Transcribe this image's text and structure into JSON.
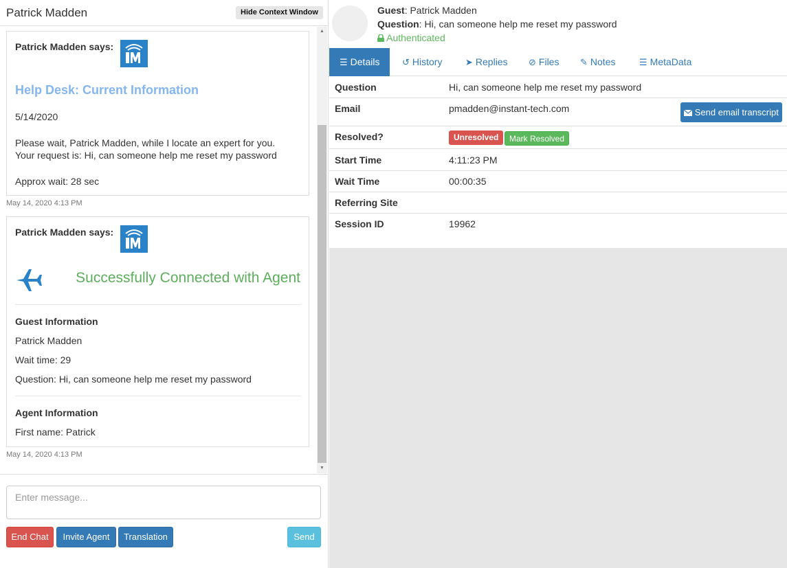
{
  "left": {
    "title": "Patrick Madden",
    "hide_context_label": "Hide Context Window"
  },
  "messages": [
    {
      "says": "Patrick Madden says:",
      "help_title": "Help Desk: Current Information",
      "date": "5/14/2020",
      "please_wait": "Please wait, Patrick Madden, while I locate an expert for you.",
      "request": "Your request is: Hi, can someone help me reset my password",
      "approx_wait": "Approx wait: 28 sec",
      "timestamp": "May 14, 2020 4:13 PM"
    },
    {
      "says": "Patrick Madden says:",
      "connected": "Successfully Connected with Agent",
      "guest_info_heading": "Guest Information",
      "guest_name": "Patrick Madden",
      "wait_time": "Wait time: 29",
      "question": "Question: Hi, can someone help me reset my password",
      "agent_info_heading": "Agent Information",
      "agent_first_name": "First name: Patrick",
      "timestamp": "May 14, 2020 4:13 PM"
    }
  ],
  "composer": {
    "placeholder": "Enter message...",
    "end_chat": "End Chat",
    "invite_agent": "Invite Agent",
    "translation": "Translation",
    "send": "Send"
  },
  "guest_header": {
    "guest_label": "Guest",
    "guest_value": "Patrick Madden",
    "question_label": "Question",
    "question_value": "Hi, can someone help me reset my password",
    "auth_status": "Authenticated"
  },
  "tabs": [
    {
      "label": "Details",
      "icon": "list-icon"
    },
    {
      "label": "History",
      "icon": "history-icon"
    },
    {
      "label": "Replies",
      "icon": "paper-plane-icon"
    },
    {
      "label": "Files",
      "icon": "paperclip-icon"
    },
    {
      "label": "Notes",
      "icon": "edit-icon"
    },
    {
      "label": "MetaData",
      "icon": "list-icon"
    }
  ],
  "details": {
    "question_label": "Question",
    "question_value": "Hi, can someone help me reset my password",
    "email_label": "Email",
    "email_value": "pmadden@instant-tech.com",
    "send_transcript": "Send email transcript",
    "resolved_label": "Resolved?",
    "unresolved_badge": "Unresolved",
    "mark_resolved": "Mark Resolved",
    "start_time_label": "Start Time",
    "start_time_value": "4:11:23 PM",
    "wait_time_label": "Wait Time",
    "wait_time_value": "00:00:35",
    "referring_site_label": "Referring Site",
    "referring_site_value": "",
    "session_id_label": "Session ID",
    "session_id_value": "19962"
  },
  "colors": {
    "primary": "#337ab7",
    "danger": "#d9534f",
    "success": "#5cb85c",
    "info": "#5bc0de",
    "help_title": "#85b6f0"
  }
}
